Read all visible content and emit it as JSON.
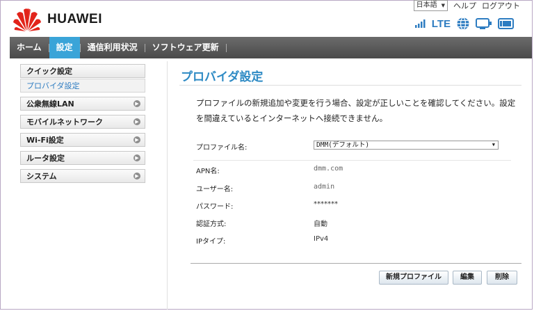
{
  "brand": {
    "name": "HUAWEI"
  },
  "topbar": {
    "language": "日本語",
    "help": "ヘルプ",
    "logout": "ログアウト"
  },
  "status": {
    "network": "LTE"
  },
  "nav": {
    "items": [
      {
        "label": "ホーム"
      },
      {
        "label": "設定"
      },
      {
        "label": "通信利用状況"
      },
      {
        "label": "ソフトウェア更新"
      }
    ],
    "active_index": 1
  },
  "sidebar": {
    "items": [
      {
        "label": "クイック設定"
      },
      {
        "label": "プロバイダ設定"
      },
      {
        "label": "公衆無線LAN"
      },
      {
        "label": "モバイルネットワーク"
      },
      {
        "label": "Wi-Fi設定"
      },
      {
        "label": "ルータ設定"
      },
      {
        "label": "システム"
      }
    ]
  },
  "main": {
    "title": "プロバイダ設定",
    "description": "プロファイルの新規追加や変更を行う場合、設定が正しいことを確認してください。設定を間違えているとインターネットへ接続できません。",
    "profile_label": "プロファイル名:",
    "profile_value": "DMM(デフォルト)",
    "fields": [
      {
        "label": "APN名:",
        "value": "dmm.com"
      },
      {
        "label": "ユーザー名:",
        "value": "admin"
      },
      {
        "label": "パスワード:",
        "value": "*******"
      },
      {
        "label": "認証方式:",
        "value": "自動"
      },
      {
        "label": "IPタイプ:",
        "value": "IPv4"
      }
    ],
    "buttons": {
      "new_profile": "新規プロファイル",
      "edit": "編集",
      "delete": "削除"
    }
  },
  "colors": {
    "accent": "#2d8ac4",
    "nav_bg": "#555555",
    "nav_active": "#3aa4d8",
    "brand_red": "#e2231a"
  }
}
